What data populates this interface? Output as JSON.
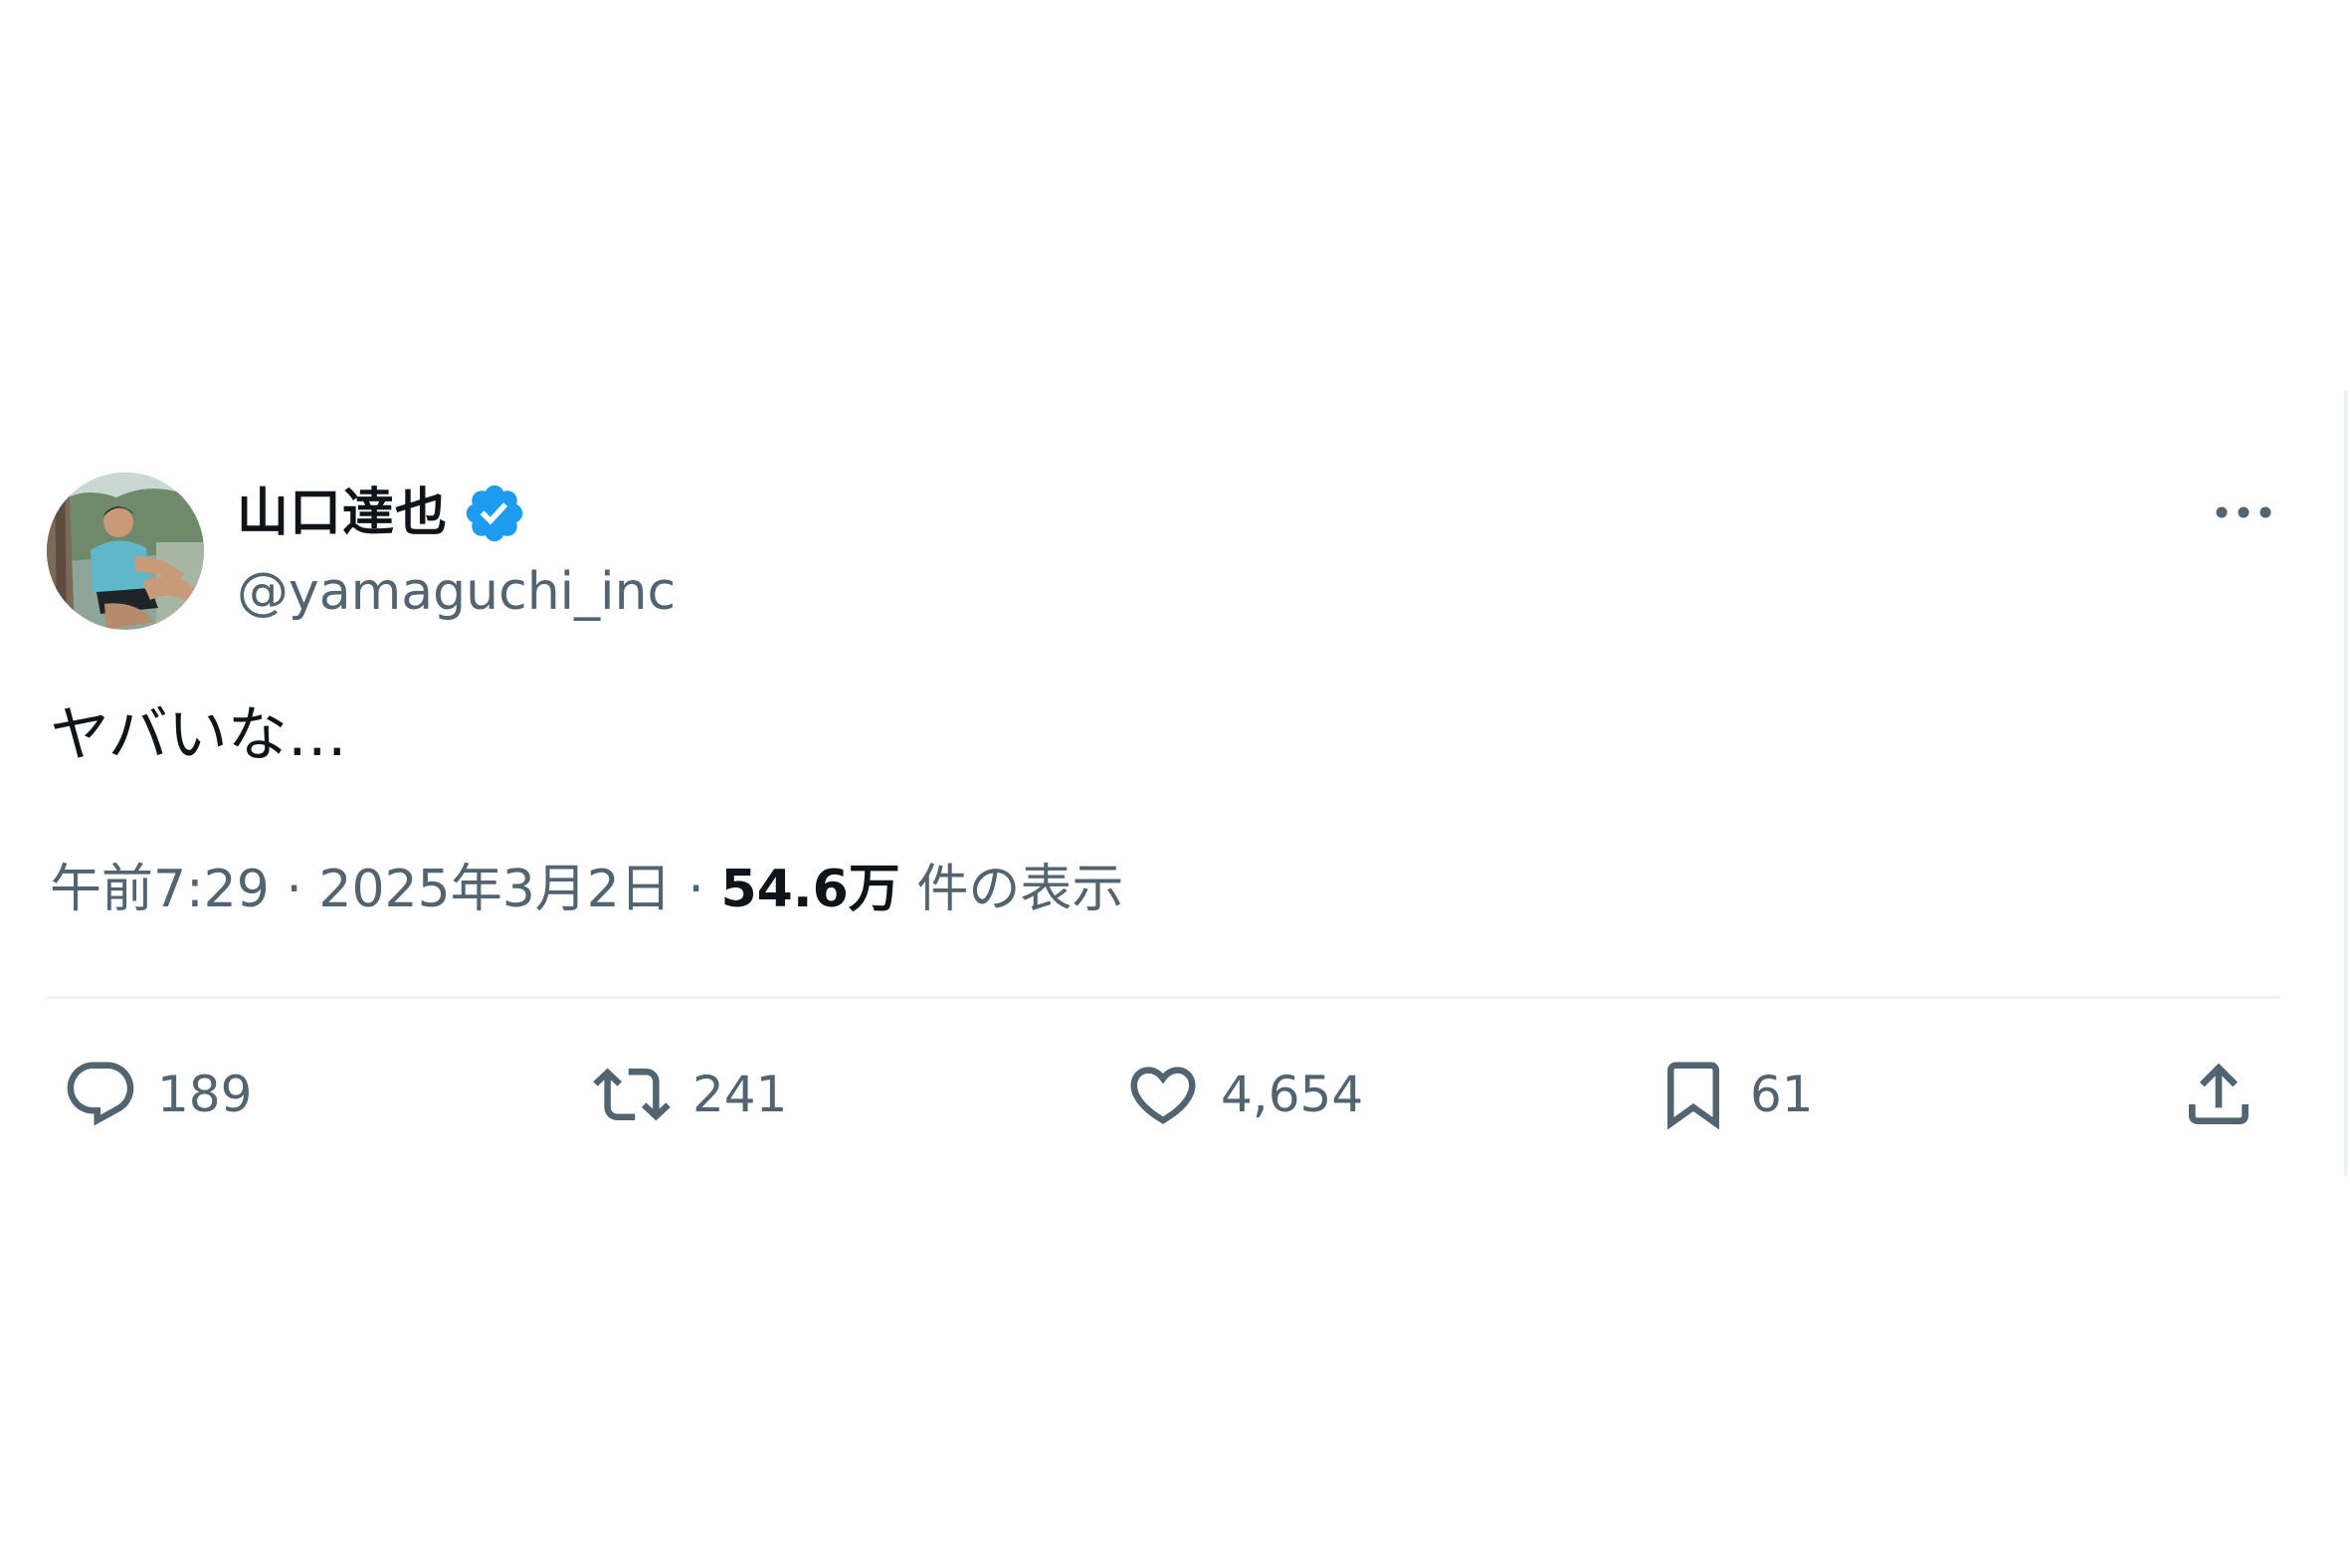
{
  "post": {
    "display_name": "山口達也",
    "verified": true,
    "handle": "@yamaguchi_inc",
    "text": "ヤバいな…",
    "time": "午前7:29",
    "separator": "·",
    "date": "2025年3月2日",
    "views_count": "54.6万",
    "views_label": "件の表示"
  },
  "actions": {
    "reply_count": "189",
    "repost_count": "241",
    "like_count": "4,654",
    "bookmark_count": "61"
  },
  "icons": {
    "verified": "verified-badge-icon",
    "more": "more-horizontal-icon",
    "reply": "reply-icon",
    "repost": "repost-icon",
    "like": "heart-icon",
    "bookmark": "bookmark-icon",
    "share": "share-icon"
  },
  "colors": {
    "accent_verified": "#1d9bf0",
    "primary_text": "#0f1419",
    "secondary_text": "#536471",
    "divider": "#eff3f4"
  }
}
